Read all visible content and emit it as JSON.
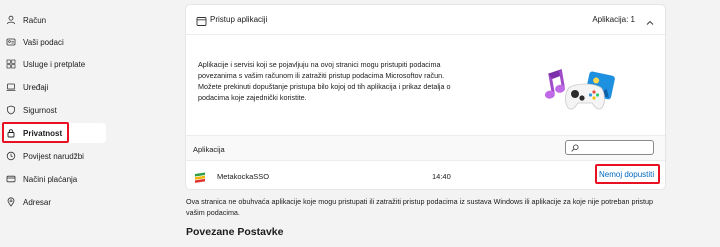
{
  "sidebar": {
    "items": [
      {
        "label": "Račun",
        "icon": "person-icon",
        "selected": false
      },
      {
        "label": "Vaši podaci",
        "icon": "id-card-icon",
        "selected": false
      },
      {
        "label": "Usluge i pretplate",
        "icon": "grid-icon",
        "selected": false
      },
      {
        "label": "Uređaji",
        "icon": "laptop-icon",
        "selected": false
      },
      {
        "label": "Sigurnost",
        "icon": "shield-icon",
        "selected": false
      },
      {
        "label": "Privatnost",
        "icon": "lock-icon",
        "selected": true
      },
      {
        "label": "Povijest narudžbi",
        "icon": "history-icon",
        "selected": false
      },
      {
        "label": "Načini plaćanja",
        "icon": "card-icon",
        "selected": false
      },
      {
        "label": "Adresar",
        "icon": "location-icon",
        "selected": false
      }
    ]
  },
  "card": {
    "title": "Pristup aplikaciji",
    "count_label": "Aplikacija: 1",
    "description": "Aplikacije i servisi koji se pojavljuju na ovoj stranici mogu pristupiti podacima povezanima s vašim računom ili zatražiti pristup podacima Microsoftov račun. Možete prekinuti dopuštanje pristupa bilo kojoj od tih aplikacija i prikaz detalja o podacima koje zajednički koristite.",
    "apps_header": "Aplikacija",
    "apps": [
      {
        "name": "MetakockaSSO",
        "time": "14:40",
        "action": "Nemoj dopustiti"
      }
    ]
  },
  "note": "Ova stranica ne obuhvaća aplikacije koje mogu pristupati ili zatražiti pristup podacima iz sustava Windows ili aplikacije za koje nije potreban pristup vašim podacima.",
  "related_title": "Povezane Postavke",
  "colors": {
    "accent": "#0067c0",
    "highlight": "#e81123",
    "background": "#f3f3f3"
  }
}
